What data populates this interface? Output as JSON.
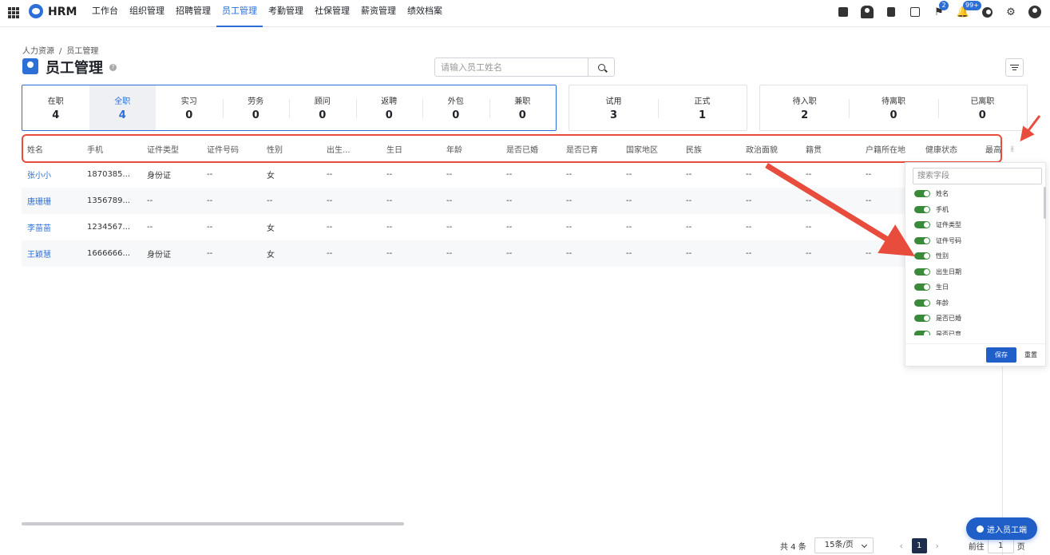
{
  "app": {
    "brand": "HRM"
  },
  "nav": [
    {
      "label": "工作台",
      "active": false
    },
    {
      "label": "组织管理",
      "active": false
    },
    {
      "label": "招聘管理",
      "active": false
    },
    {
      "label": "员工管理",
      "active": true
    },
    {
      "label": "考勤管理",
      "active": false
    },
    {
      "label": "社保管理",
      "active": false
    },
    {
      "label": "薪资管理",
      "active": false
    },
    {
      "label": "绩效档案",
      "active": false
    }
  ],
  "toolbar": {
    "icons": [
      "calendar-check-icon",
      "person-icon",
      "document-icon",
      "calendar-icon",
      "flag-icon",
      "bell-icon",
      "help-icon",
      "gear-icon",
      "avatar-icon"
    ],
    "flag_badge": "2",
    "bell_badge": "99+"
  },
  "breadcrumb": [
    "人力资源",
    "/",
    "员工管理"
  ],
  "page": {
    "title": "员工管理"
  },
  "search": {
    "placeholder": "请输入员工姓名",
    "value": ""
  },
  "stats": {
    "group1": [
      {
        "label": "在职",
        "value": "4"
      },
      {
        "label": "全职",
        "value": "4"
      },
      {
        "label": "实习",
        "value": "0"
      },
      {
        "label": "劳务",
        "value": "0"
      },
      {
        "label": "顾问",
        "value": "0"
      },
      {
        "label": "返聘",
        "value": "0"
      },
      {
        "label": "外包",
        "value": "0"
      },
      {
        "label": "兼职",
        "value": "0"
      }
    ],
    "group2": [
      {
        "label": "试用",
        "value": "3"
      },
      {
        "label": "正式",
        "value": "1"
      }
    ],
    "group3": [
      {
        "label": "待入职",
        "value": "2"
      },
      {
        "label": "待离职",
        "value": "0"
      },
      {
        "label": "已离职",
        "value": "0"
      }
    ]
  },
  "table": {
    "columns": [
      "姓名",
      "手机",
      "证件类型",
      "证件号码",
      "性别",
      "出生...",
      "生日",
      "年龄",
      "是否已婚",
      "是否已育",
      "国家地区",
      "民族",
      "政治面貌",
      "籍贯",
      "户籍所在地",
      "健康状态",
      "最高"
    ],
    "rows": [
      [
        "张小小",
        "1870385...",
        "身份证",
        "--",
        "女",
        "--",
        "--",
        "--",
        "--",
        "--",
        "--",
        "--",
        "--",
        "--",
        "--",
        "",
        ""
      ],
      [
        "唐珊珊",
        "1356789...",
        "--",
        "--",
        "--",
        "--",
        "--",
        "--",
        "--",
        "--",
        "--",
        "--",
        "--",
        "--",
        "--",
        "",
        ""
      ],
      [
        "李苗苗",
        "1234567...",
        "--",
        "--",
        "女",
        "--",
        "--",
        "--",
        "--",
        "--",
        "--",
        "--",
        "--",
        "--",
        "--",
        "",
        ""
      ],
      [
        "王颖慧",
        "1666666...",
        "身份证",
        "--",
        "女",
        "--",
        "--",
        "--",
        "--",
        "--",
        "--",
        "--",
        "--",
        "--",
        "--",
        "",
        ""
      ]
    ]
  },
  "column_panel": {
    "search_placeholder": "搜索字段",
    "fields": [
      "姓名",
      "手机",
      "证件类型",
      "证件号码",
      "性别",
      "出生日期",
      "生日",
      "年龄",
      "是否已婚",
      "是否已育"
    ],
    "save_label": "保存",
    "reset_label": "重置"
  },
  "pagination": {
    "total": "共 4 条",
    "page_size": "15条/页",
    "prev": "‹",
    "current": "1",
    "next": "›",
    "goto_prefix": "前往",
    "goto_value": "1",
    "goto_suffix": "页"
  },
  "float_button": {
    "label": "进入员工端"
  },
  "colors": {
    "accent": "#2c6fd6",
    "annotation": "#e74c3c",
    "toggle_on": "#3a8a3a"
  }
}
